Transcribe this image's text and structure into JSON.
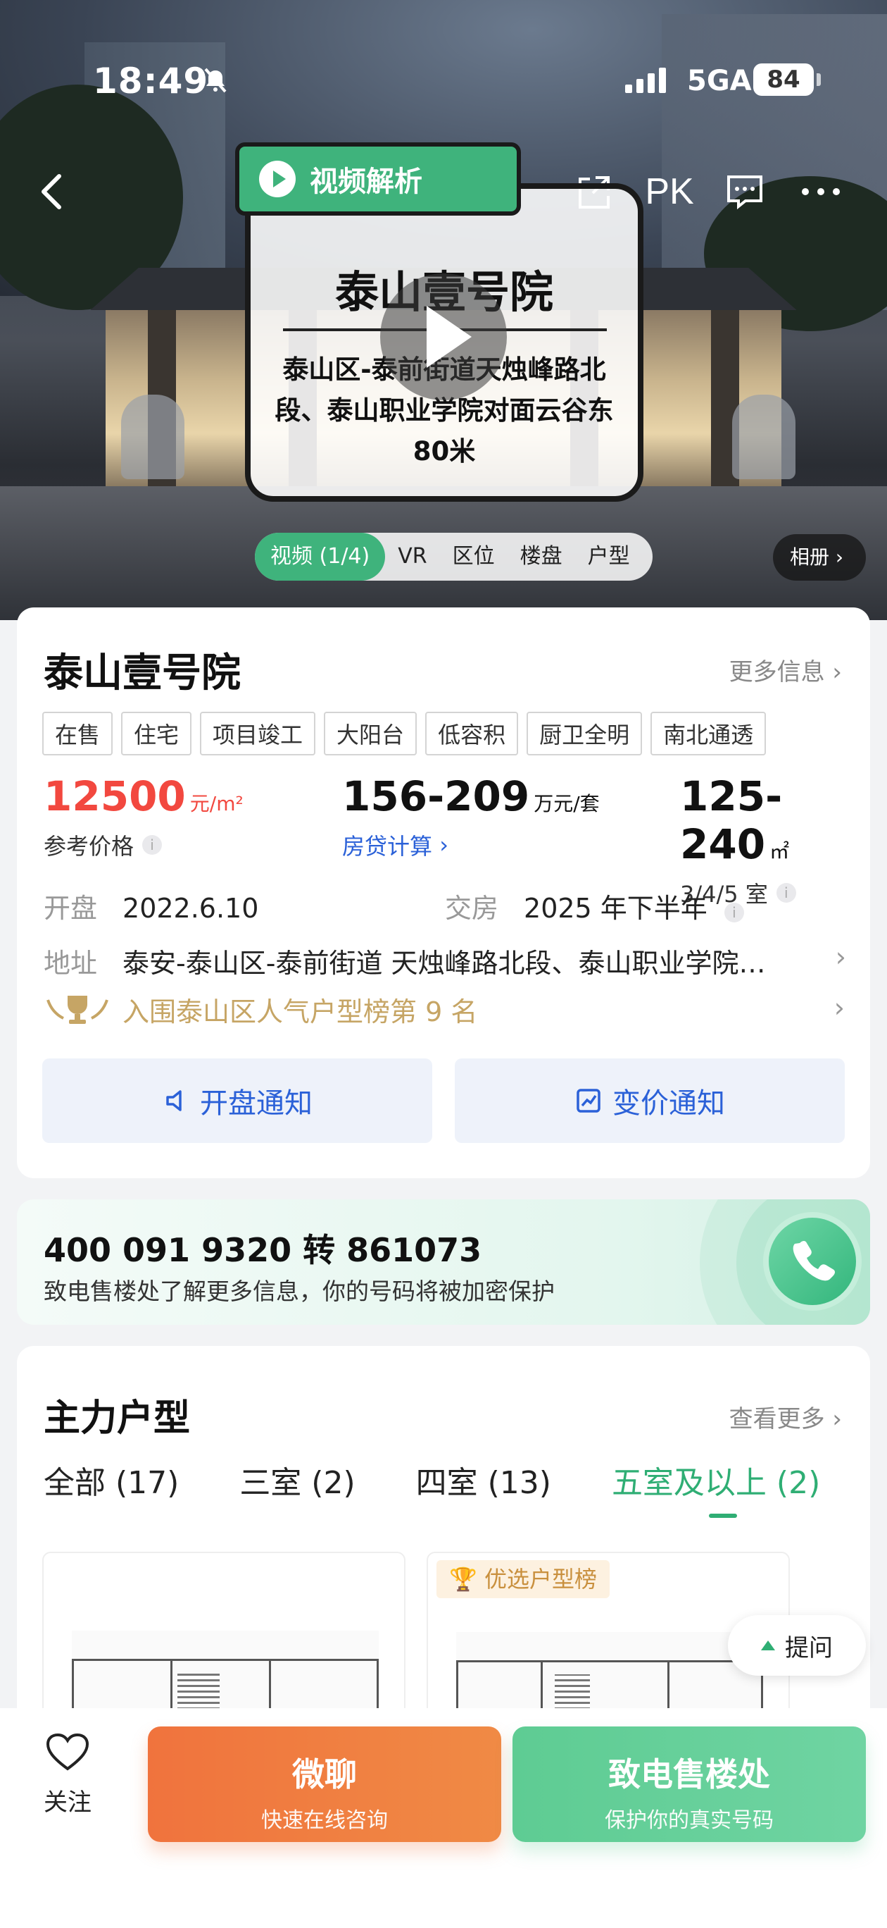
{
  "status_bar": {
    "time": "18:49",
    "network": "5GA",
    "battery": "84"
  },
  "video_card": {
    "tag": "视频解析",
    "title": "泰山壹号院",
    "address": "泰山区-泰前街道天烛峰路北段、泰山职业学院对面云谷东80米"
  },
  "top_nav": {
    "pk": "PK"
  },
  "media_tabs": [
    "视频 (1/4)",
    "VR",
    "区位",
    "楼盘",
    "户型"
  ],
  "album": "相册",
  "project": {
    "name": "泰山壹号院",
    "more_info": "更多信息",
    "tags": [
      "在售",
      "住宅",
      "项目竣工",
      "大阳台",
      "低容积",
      "厨卫全明",
      "南北通透"
    ],
    "price": {
      "value": "12500",
      "unit": "元/m²",
      "label": "参考价格"
    },
    "total": {
      "value": "156-209",
      "unit": "万元/套",
      "label": "房贷计算"
    },
    "area": {
      "value": "125-240",
      "unit": "㎡",
      "label": "3/4/5 室"
    },
    "open_label": "开盘",
    "open_date": "2022.6.10",
    "delivery_label": "交房",
    "delivery_date": "2025 年下半年",
    "address_label": "地址",
    "address": "泰安-泰山区-泰前街道 天烛峰路北段、泰山职业学院…",
    "rank_text": "入围泰山区人气户型榜第 9 名",
    "notify_open": "开盘通知",
    "notify_price": "变价通知"
  },
  "phone": {
    "number": "400 091 9320 转 861073",
    "desc": "致电售楼处了解更多信息，你的号码将被加密保护"
  },
  "layouts": {
    "title": "主力户型",
    "more": "查看更多",
    "tabs": [
      "全部 (17)",
      "三室 (2)",
      "四室 (13)",
      "五室及以上 (2)"
    ],
    "badge": "优选户型榜"
  },
  "ask": "提问",
  "bottom": {
    "follow": "关注",
    "chat_title": "微聊",
    "chat_sub": "快速在线咨询",
    "call_title": "致电售楼处",
    "call_sub": "保护你的真实号码"
  },
  "colors": {
    "accent_green": "#3fb37c",
    "price_red": "#f2483f",
    "link_blue": "#2b61d8",
    "cta_orange": "#f0733d",
    "gold": "#c6a565"
  }
}
